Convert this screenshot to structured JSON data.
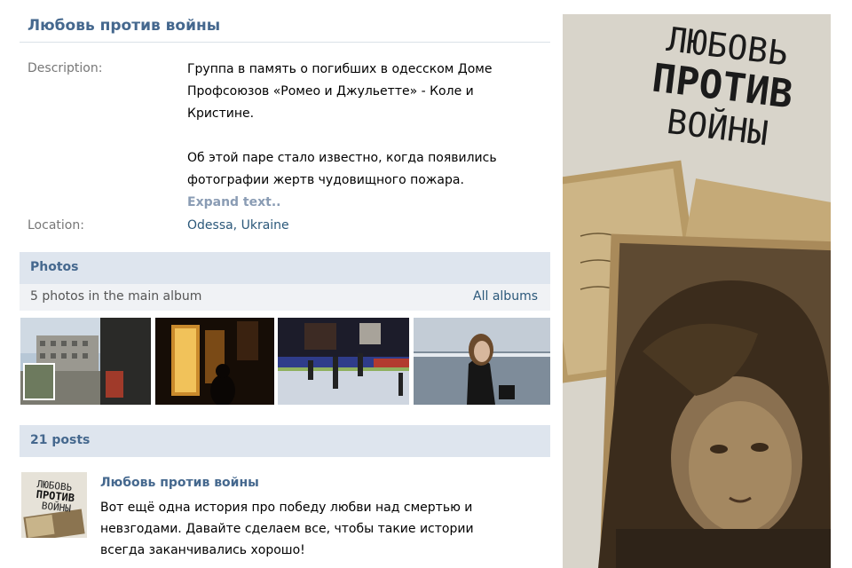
{
  "group": {
    "title": "Любовь против войны"
  },
  "info": {
    "description_label": "Description:",
    "description_p1": "Группа в память о погибших в одесском Доме Профсоюзов «Ромео и Джульетте» - Коле и Кристине.",
    "description_p2": "Об этой паре стало известно, когда появились фотографии жертв чудовищного пожара.",
    "expand_label": "Expand text..",
    "location_label": "Location:",
    "location_value": "Odessa, Ukraine"
  },
  "photos": {
    "header": "Photos",
    "count_text": "5 photos in the main album",
    "all_albums": "All albums"
  },
  "posts": {
    "header": "21 posts",
    "items": [
      {
        "author": "Любовь против войны",
        "text": "Вот ещё одна история про победу любви над смертью и невзгодами. Давайте сделаем все, чтобы такие истории всегда заканчивались хорошо!"
      }
    ]
  },
  "poster": {
    "line1": "ЛЮБОВЬ",
    "line2": "ПРОТИВ",
    "line3": "ВОЙНЫ"
  },
  "thumb_art": {
    "line1": "ЛЮБОВЬ",
    "line2": "ПРОТИВ",
    "line3": "ВОЙНЫ"
  },
  "colors": {
    "link": "#2b587a",
    "heading": "#45688e",
    "section_bg": "#dee5ee"
  }
}
